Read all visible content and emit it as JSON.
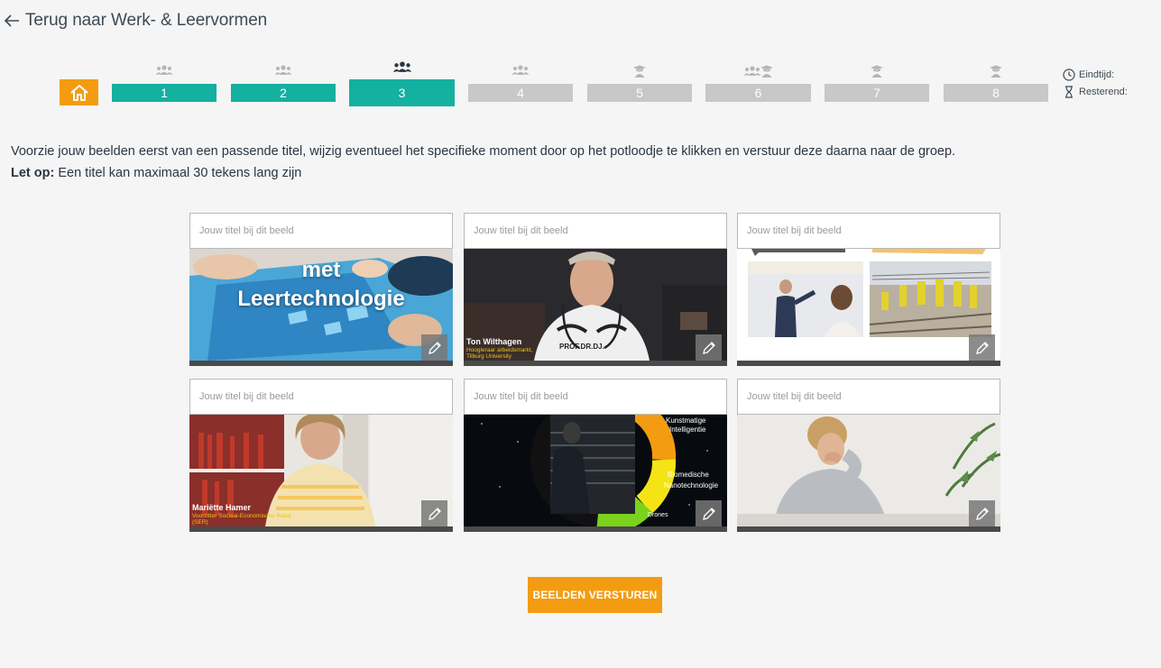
{
  "nav": {
    "back_label": "Terug naar Werk- & Leervormen"
  },
  "stepper": {
    "steps": [
      {
        "label": "1",
        "icon": "group-icon",
        "state": "done"
      },
      {
        "label": "2",
        "icon": "group-icon",
        "state": "done"
      },
      {
        "label": "3",
        "icon": "group-icon",
        "state": "active"
      },
      {
        "label": "4",
        "icon": "group-icon",
        "state": "todo"
      },
      {
        "label": "5",
        "icon": "graduate-icon",
        "state": "todo"
      },
      {
        "label": "6",
        "icon": "group-graduate-icon",
        "state": "todo"
      },
      {
        "label": "7",
        "icon": "graduate-icon",
        "state": "todo"
      },
      {
        "label": "8",
        "icon": "graduate-icon",
        "state": "todo"
      }
    ]
  },
  "timer": {
    "end_label": "Eindtijd:",
    "remaining_label": "Resterend:"
  },
  "instructions": {
    "line1": "Voorzie jouw beelden eerst van een passende titel, wijzig eventueel het specifieke moment door op het potloodje te klikken en verstuur deze daarna naar de groep.",
    "note_bold": "Let op:",
    "note_text": " Een titel kan maximaal 30 tekens lang zijn"
  },
  "cards": {
    "placeholder": "Jouw titel bij dit beeld",
    "items": [
      {
        "overlay_line1": "met",
        "overlay_line2": "Leertechnologie"
      },
      {
        "caption_name": "Ton Wilthagen",
        "caption_sub": "Hoogleraar arbeidsmarkt, Tilburg University",
        "shirt_text": "PROF.DR.DJ."
      },
      {},
      {
        "caption_name": "Mariëtte Hamer",
        "caption_sub": "Voorzitter Sociaal-Economische Raad (SER)"
      },
      {
        "labels": [
          "Kunstmatige",
          "Intelligentie",
          "Biomedische",
          "Nanotechnologie",
          "Drones"
        ]
      },
      {}
    ]
  },
  "actions": {
    "send_label": "BEELDEN VERSTUREN"
  },
  "colors": {
    "accent": "#f39c12",
    "teal": "#14b0a0",
    "inactive": "#c8c8c8"
  }
}
